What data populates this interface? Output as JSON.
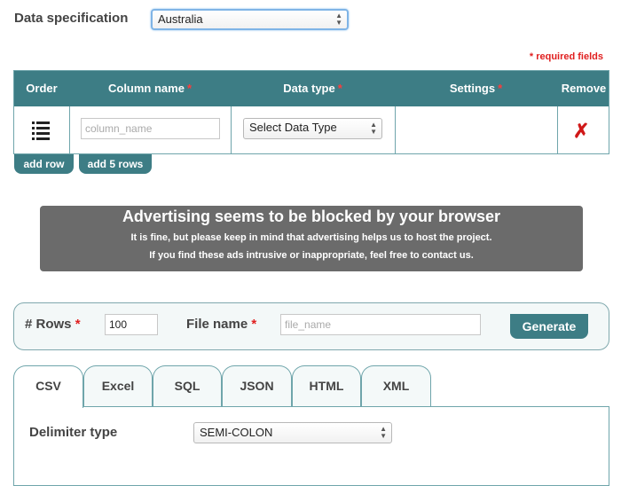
{
  "spec": {
    "label": "Data specification",
    "country": "Australia"
  },
  "required_note": "* required fields",
  "table": {
    "headers": {
      "order": "Order",
      "column_name": "Column name",
      "data_type": "Data type",
      "settings": "Settings",
      "remove": "Remove"
    },
    "required_mark": "*",
    "row": {
      "column_placeholder": "column_name",
      "data_type_value": "Select Data Type"
    },
    "add_row": "add row",
    "add_5_rows": "add 5 rows"
  },
  "ad": {
    "title": "Advertising seems to be blocked by your browser",
    "line1": "It is fine, but please keep in mind that advertising helps us to host the project.",
    "line2": "If you find these ads intrusive or inappropriate, feel free to contact us."
  },
  "generate_panel": {
    "rows_label": "# Rows",
    "rows_value": "100",
    "file_label": "File name",
    "file_placeholder": "file_name",
    "required_mark": "*",
    "generate": "Generate"
  },
  "tabs": [
    "CSV",
    "Excel",
    "SQL",
    "JSON",
    "HTML",
    "XML"
  ],
  "active_tab": "CSV",
  "csv_panel": {
    "delimiter_label": "Delimiter type",
    "delimiter_value": "SEMI-COLON"
  },
  "icons": {
    "order": "drag-handle-icon",
    "remove": "remove-x-icon",
    "select": "up-down-arrows-icon"
  },
  "colors": {
    "accent": "#3d7d85",
    "required": "#e02020",
    "ad_background": "#6b6b6b"
  }
}
